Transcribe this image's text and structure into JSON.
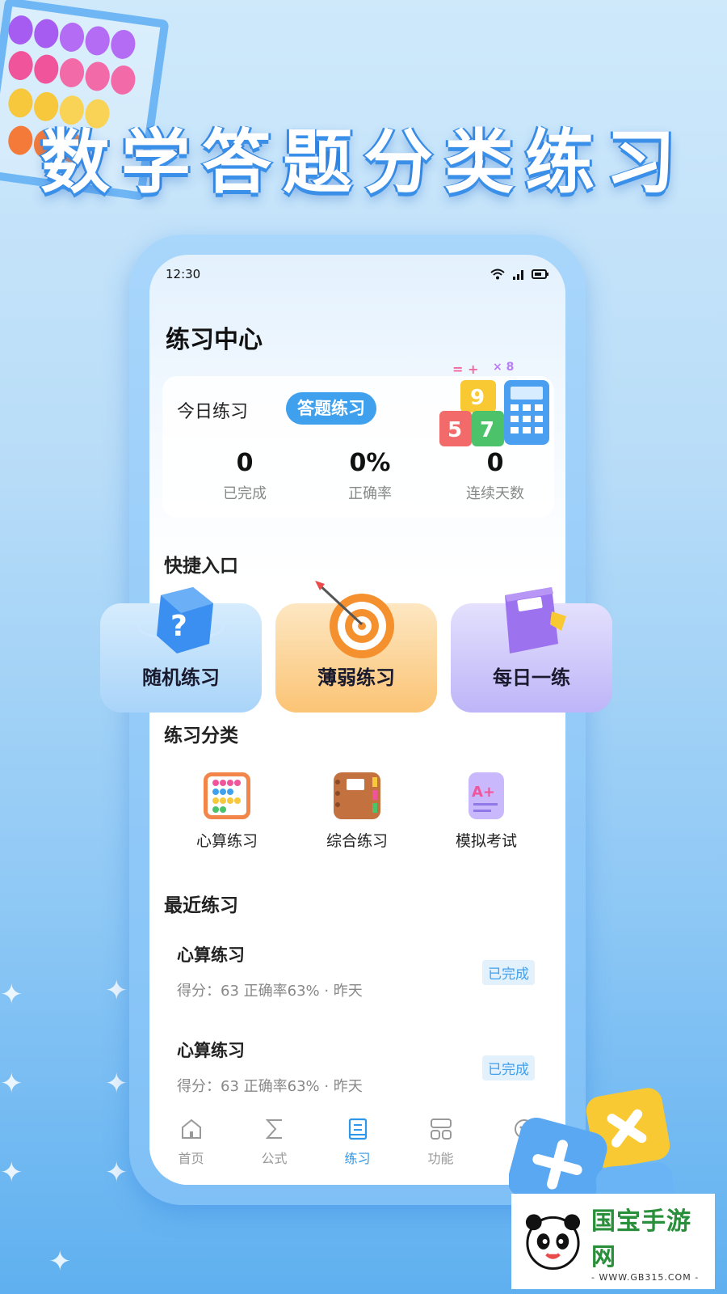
{
  "promo": {
    "title": "数学答题分类练习"
  },
  "status_bar": {
    "time": "12:30"
  },
  "page": {
    "title": "练习中心"
  },
  "today": {
    "label": "今日练习",
    "pill": "答题练习",
    "stats": [
      {
        "value": "0",
        "label": "已完成"
      },
      {
        "value": "0%",
        "label": "正确率"
      },
      {
        "value": "0",
        "label": "连续天数"
      }
    ]
  },
  "quick": {
    "section_title": "快捷入口",
    "items": [
      {
        "label": "随机练习",
        "icon": "dice-icon",
        "color": "#bfe0fb"
      },
      {
        "label": "薄弱练习",
        "icon": "target-icon",
        "color": "#fcd79a"
      },
      {
        "label": "每日一练",
        "icon": "book-icon",
        "color": "#d6d2fb"
      }
    ]
  },
  "categories": {
    "section_title": "练习分类",
    "items": [
      {
        "label": "心算练习",
        "icon": "abacus-icon"
      },
      {
        "label": "综合练习",
        "icon": "notebook-icon"
      },
      {
        "label": "模拟考试",
        "icon": "exam-paper-icon"
      }
    ]
  },
  "recent": {
    "section_title": "最近练习",
    "items": [
      {
        "title": "心算练习",
        "meta": "得分：63 正确率63% · 昨天",
        "badge": "已完成"
      },
      {
        "title": "心算练习",
        "meta": "得分：63 正确率63% · 昨天",
        "badge": "已完成"
      }
    ]
  },
  "nav": {
    "items": [
      {
        "label": "首页",
        "icon": "home-icon"
      },
      {
        "label": "公式",
        "icon": "sigma-icon"
      },
      {
        "label": "练习",
        "icon": "book-icon",
        "active": true
      },
      {
        "label": "功能",
        "icon": "grid-icon"
      },
      {
        "label": "",
        "icon": "chat-icon"
      }
    ]
  },
  "watermark": {
    "brand": "国宝手游网",
    "url": "- WWW.GB315.COM -"
  },
  "colors": {
    "accent": "#3fa0ee",
    "active_nav": "#2e97ea"
  }
}
